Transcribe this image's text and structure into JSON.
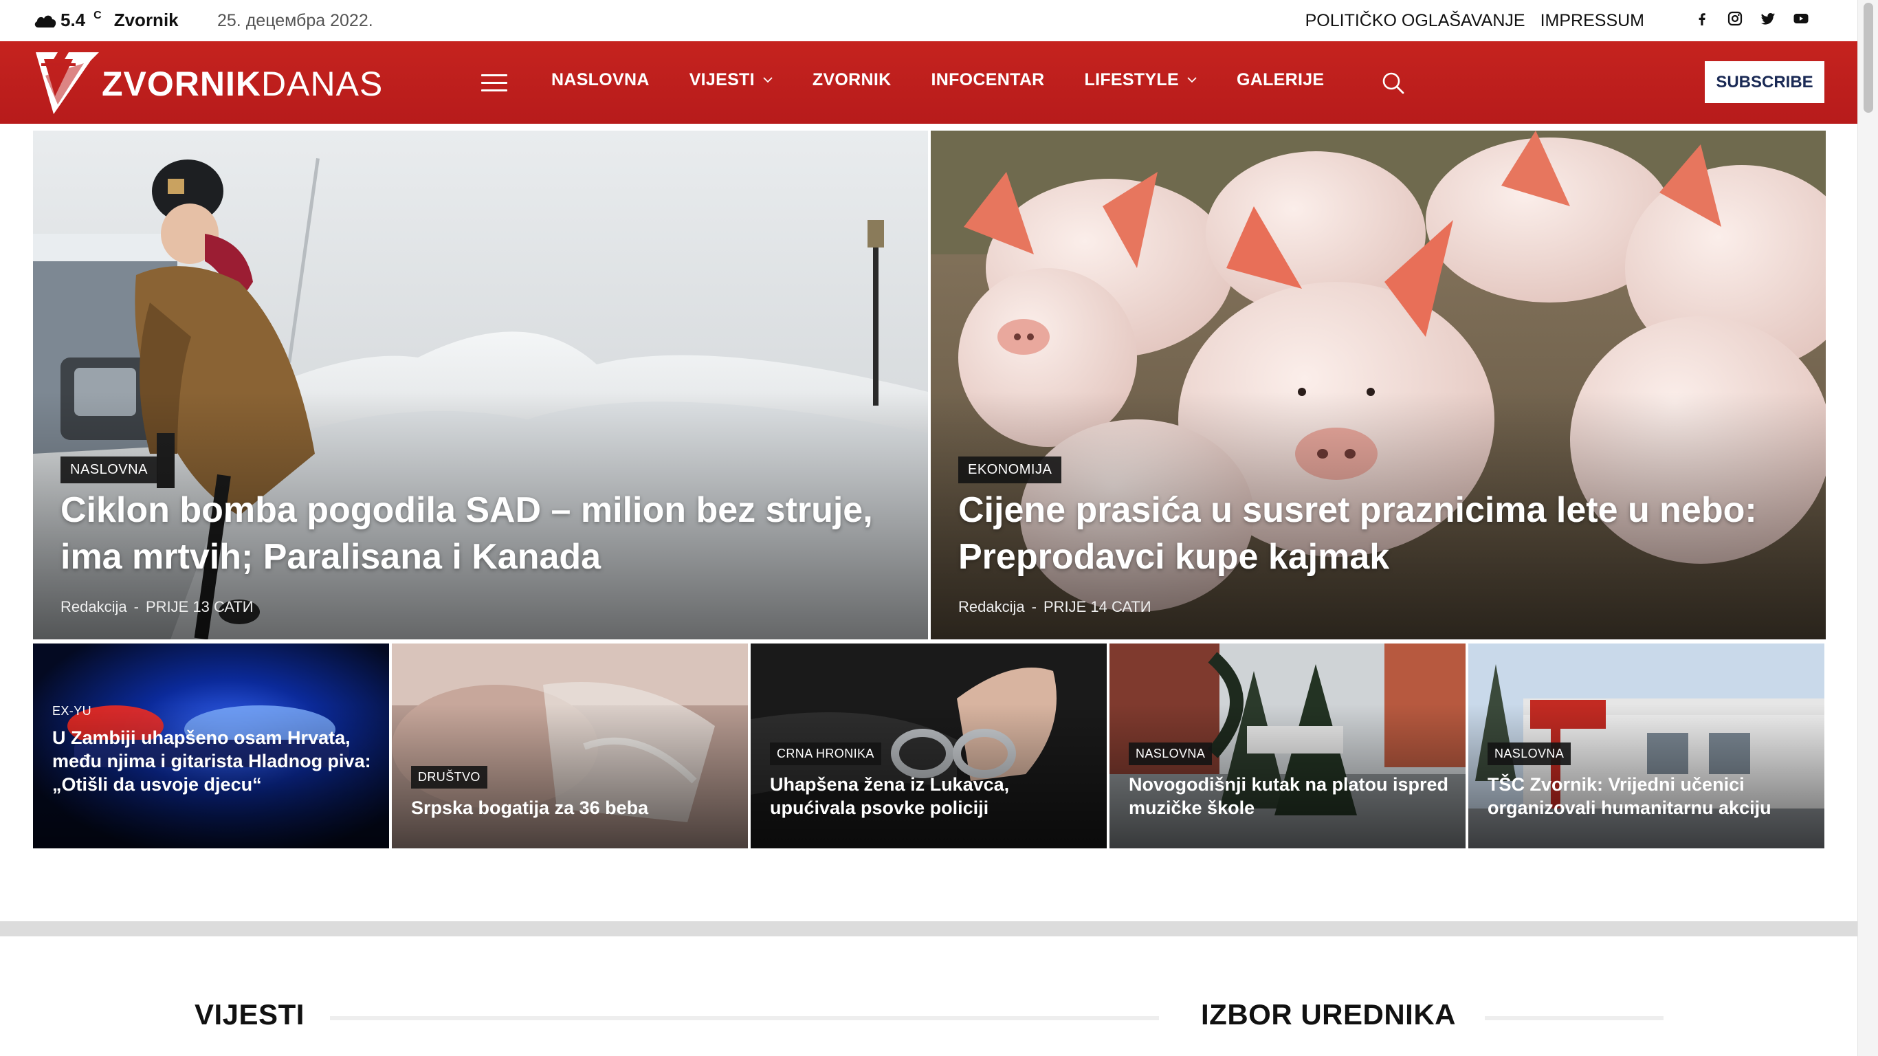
{
  "topbar": {
    "weather_temp": "5.4",
    "weather_unit": "C",
    "weather_city": "Zvornik",
    "weather_icon": "cloud-icon",
    "date": "25. децембра 2022.",
    "links": [
      "POLITIČKO OGLAŠAVANJE",
      "IMPRESSUM"
    ],
    "socials": [
      "facebook-icon",
      "instagram-icon",
      "twitter-icon",
      "youtube-icon"
    ]
  },
  "header": {
    "logo_bold": "ZVORNIK",
    "logo_light": "DANAS",
    "nav": [
      {
        "label": "NASLOVNA",
        "dropdown": false
      },
      {
        "label": "VIJESTI",
        "dropdown": true
      },
      {
        "label": "ZVORNIK",
        "dropdown": false
      },
      {
        "label": "INFOCENTAR",
        "dropdown": false
      },
      {
        "label": "LIFESTYLE",
        "dropdown": true
      },
      {
        "label": "GALERIJE",
        "dropdown": false
      }
    ],
    "subscribe_label": "SUBSCRIBE",
    "brand_color": "#c0201f"
  },
  "featured": [
    {
      "category": "NASLOVNA",
      "title": "Ciklon bomba pogodila SAD – milion bez struje, ima mrtvih; Paralisana i Kanada",
      "author": "Redakcija",
      "separator": "-",
      "time": "PRIJE 13 САТИ"
    },
    {
      "category": "EKONOMIJA",
      "title": "Cijene prasića u susret praznicima lete u nebo: Preprodavci kupe kajmak",
      "author": "Redakcija",
      "separator": "-",
      "time": "PRIJE 14 САТИ"
    }
  ],
  "small_tiles": [
    {
      "category": "EX-YU",
      "title": "U Zambiji uhapšeno osam Hrvata, među njima i gitarista Hladnog piva: „Otišli da usvoje djecu“"
    },
    {
      "category": "DRUŠTVO",
      "title": "Srpska bogatija za 36 beba"
    },
    {
      "category": "CRNA HRONIKA",
      "title": "Uhapšena žena iz Lukavca, upućivala psovke policiji"
    },
    {
      "category": "NASLOVNA",
      "title": "Novogodišnji kutak na platou ispred muzičke škole"
    },
    {
      "category": "NASLOVNA",
      "title": "TŠC Zvornik: Vrijedni učenici organizovali humanitarnu akciju"
    }
  ],
  "sections": {
    "left": "VIJESTI",
    "right": "IZBOR UREDNIKA"
  }
}
